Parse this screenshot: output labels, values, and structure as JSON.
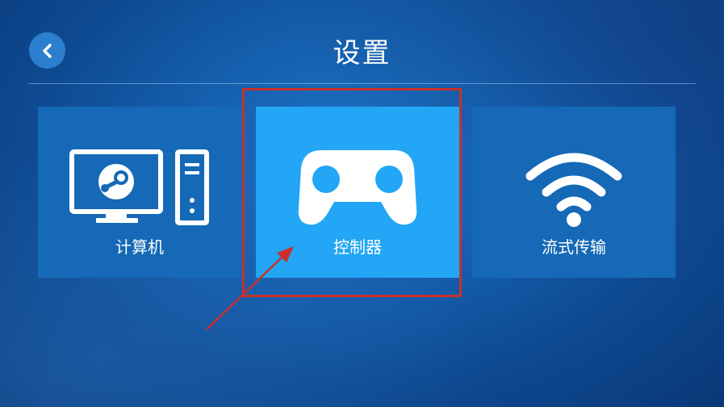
{
  "header": {
    "title": "设置",
    "back_icon": "chevron-left-icon"
  },
  "tiles": [
    {
      "label": "计算机",
      "icon": "computer-steam-icon",
      "selected": false
    },
    {
      "label": "控制器",
      "icon": "gamepad-icon",
      "selected": true
    },
    {
      "label": "流式传输",
      "icon": "wifi-icon",
      "selected": false
    }
  ],
  "colors": {
    "tile": "#1569b6",
    "tile_selected": "#22a6f5",
    "annotation": "#c9302c",
    "text": "#ffffff"
  }
}
